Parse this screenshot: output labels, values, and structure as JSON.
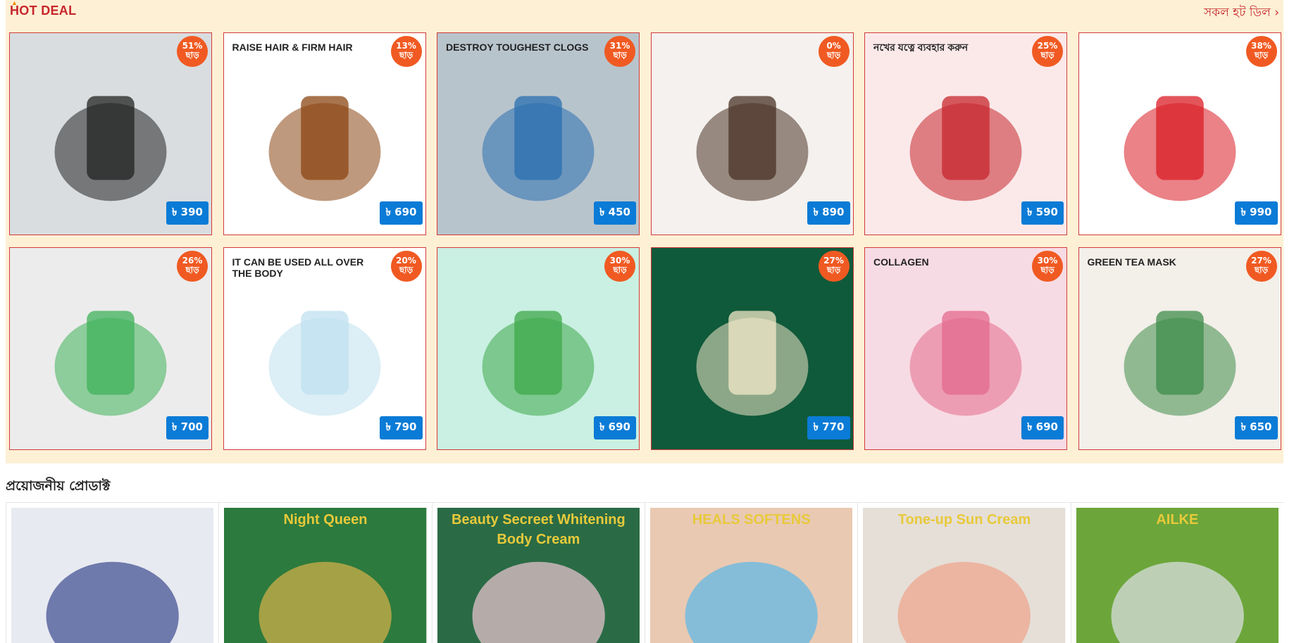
{
  "hot_deal": {
    "title": "HOT DEAL",
    "view_all": "সকল হট ডিল ›",
    "items": [
      {
        "discount": "51%",
        "off": "ছাড়",
        "price": "৳ 390",
        "caption": "",
        "bg": "#d9dde0",
        "accent": "#222222"
      },
      {
        "discount": "13%",
        "off": "ছাড়",
        "price": "৳ 690",
        "caption": "RAISE HAIR & FIRM HAIR",
        "bg": "#ffffff",
        "accent": "#8b4513"
      },
      {
        "discount": "31%",
        "off": "ছাড়",
        "price": "৳ 450",
        "caption": "DESTROY TOUGHEST CLOGS",
        "bg": "#b8c4cc",
        "accent": "#2a6fb0"
      },
      {
        "discount": "0%",
        "off": "ছাড়",
        "price": "৳ 890",
        "caption": "",
        "bg": "#f4f1ee",
        "accent": "#4a3226"
      },
      {
        "discount": "25%",
        "off": "ছাড়",
        "price": "৳ 590",
        "caption": "নখের যত্নে ব্যবহার করুন",
        "bg": "#fbe9ea",
        "accent": "#c7262c"
      },
      {
        "discount": "38%",
        "off": "ছাড়",
        "price": "৳ 990",
        "caption": "",
        "bg": "#ffffff",
        "accent": "#d91c24"
      },
      {
        "discount": "26%",
        "off": "ছাড়",
        "price": "৳ 700",
        "caption": "",
        "bg": "#ececec",
        "accent": "#3fb25a"
      },
      {
        "discount": "20%",
        "off": "ছাড়",
        "price": "৳ 790",
        "caption": "IT CAN BE USED ALL OVER THE BODY",
        "bg": "#ffffff",
        "accent": "#bfe0ef"
      },
      {
        "discount": "30%",
        "off": "ছাড়",
        "price": "৳ 690",
        "caption": "",
        "bg": "#c9f0e2",
        "accent": "#3da848"
      },
      {
        "discount": "27%",
        "off": "ছাড়",
        "price": "৳ 770",
        "caption": "",
        "bg": "#0f5a3a",
        "accent": "#f3e8c8"
      },
      {
        "discount": "30%",
        "off": "ছাড়",
        "price": "৳ 690",
        "caption": "COLLAGEN",
        "bg": "#f7dbe4",
        "accent": "#e46a8d"
      },
      {
        "discount": "27%",
        "off": "ছাড়",
        "price": "৳ 650",
        "caption": "GREEN TEA MASK",
        "bg": "#f3efe9",
        "accent": "#3e8c4a"
      }
    ]
  },
  "essentials": {
    "title": "প্রয়োজনীয় প্রোডাক্ট",
    "items": [
      {
        "caption": "",
        "bg": "#e8eaf1",
        "accent": "#3c4a8f"
      },
      {
        "caption": "Night Queen",
        "bg": "#2c7a3d",
        "accent": "#d8b24a"
      },
      {
        "caption": "Beauty Secreet Whitening Body Cream",
        "bg": "#2a6b45",
        "accent": "#f1c8d6"
      },
      {
        "caption": "HEALS SOFTENS",
        "bg": "#e9c9b2",
        "accent": "#5ab8e8"
      },
      {
        "caption": "Tone-up Sun Cream",
        "bg": "#e5dfd7",
        "accent": "#f0a38a"
      },
      {
        "caption": "AILKE",
        "bg": "#6ca63a",
        "accent": "#dfe3ea"
      }
    ]
  }
}
